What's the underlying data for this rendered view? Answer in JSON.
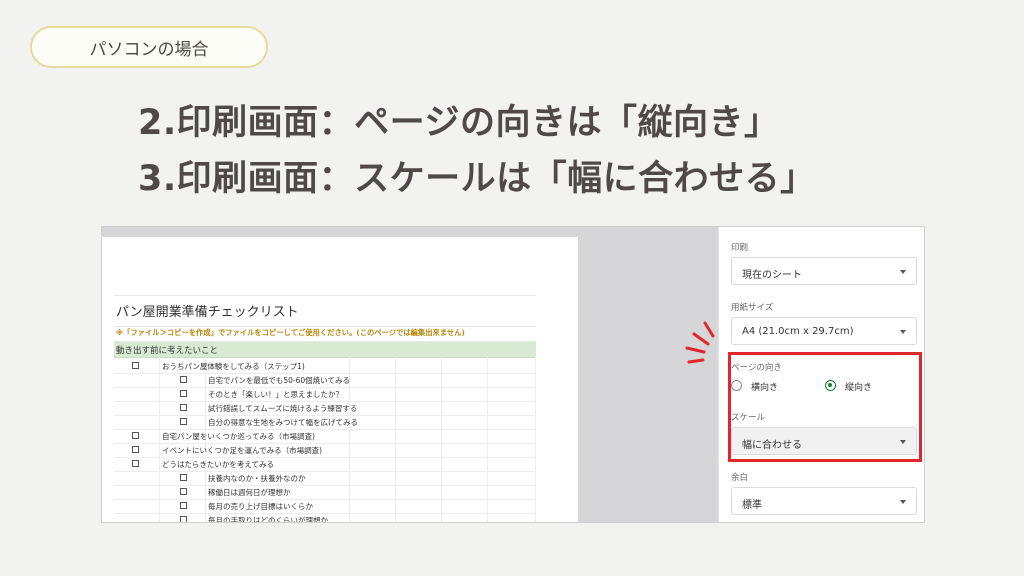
{
  "badge": {
    "label": "パソコンの場合"
  },
  "headlines": [
    "2.印刷画面：ページの向きは「縦向き」",
    "3.印刷画面：スケールは「幅に合わせる」"
  ],
  "sheet": {
    "title": "パン屋開業準備チェックリスト",
    "note": "※「ファイル＞コピーを作成」でファイルをコピーしてご使用ください。(このページでは編集出来ません)",
    "section": "動き出す前に考えたいこと",
    "items": [
      {
        "level": 1,
        "text": "おうちパン屋体験をしてみる（ステップ1)"
      },
      {
        "level": 2,
        "text": "自宅でパンを最低でも50-60個焼いてみる"
      },
      {
        "level": 2,
        "text": "そのとき「楽しい！」と思えましたか？"
      },
      {
        "level": 2,
        "text": "試行錯誤してスムーズに焼けるよう練習する"
      },
      {
        "level": 2,
        "text": "自分の得意な生地をみつけて幅を広げてみる"
      },
      {
        "level": 1,
        "text": "自宅パン屋をいくつか巡ってみる（市場調査)"
      },
      {
        "level": 1,
        "text": "イベントにいくつか足を運んでみる（市場調査)"
      },
      {
        "level": 1,
        "text": "どうはたらきたいかを考えてみる"
      },
      {
        "level": 2,
        "text": "扶養内なのか・扶養外なのか"
      },
      {
        "level": 2,
        "text": "稼働日は週何日が理想か"
      },
      {
        "level": 2,
        "text": "毎月の売り上げ目標はいくらか"
      },
      {
        "level": 2,
        "text": "毎月の手取りはどのくらいが理想か"
      }
    ]
  },
  "panel": {
    "print_label": "印刷",
    "print_value": "現在のシート",
    "paper_label": "用紙サイズ",
    "paper_value": "A4 (21.0cm x 29.7cm)",
    "orientation_label": "ページの向き",
    "landscape_label": "横向き",
    "portrait_label": "縦向き",
    "orientation_selected": "portrait",
    "scale_label": "スケール",
    "scale_value": "幅に合わせる",
    "margin_label": "余白",
    "margin_value": "標準"
  },
  "colors": {
    "highlight_border": "#e3262c",
    "section_fill": "#d9ead3",
    "radio_selected": "#188038",
    "note_text": "#b8860b"
  }
}
